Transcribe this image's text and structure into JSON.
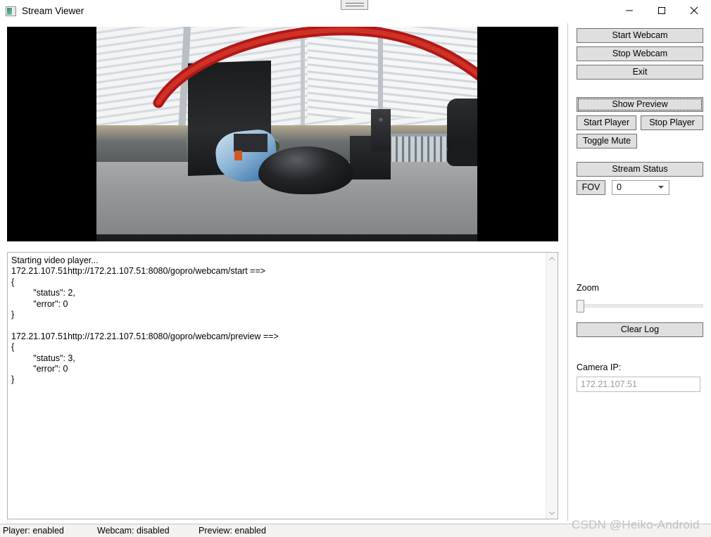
{
  "window": {
    "title": "Stream Viewer",
    "icon": "picture-icon",
    "controls": {
      "minimize": "minimize-icon",
      "maximize": "maximize-icon",
      "close": "close-icon"
    }
  },
  "video": {
    "label": "live-video-preview",
    "background_color": "#000000"
  },
  "controls": {
    "start_webcam": "Start Webcam",
    "stop_webcam": "Stop Webcam",
    "exit": "Exit",
    "show_preview": "Show Preview",
    "start_player": "Start Player",
    "stop_player": "Stop Player",
    "toggle_mute": "Toggle Mute",
    "stream_status": "Stream Status",
    "fov": "FOV",
    "fov_value": "0",
    "clear_log": "Clear Log",
    "zoom_label": "Zoom",
    "zoom_value": "0",
    "camera_ip_label": "Camera IP:",
    "camera_ip_value": "172.21.107.51"
  },
  "log": {
    "content": "Starting video player...\n172.21.107.51http://172.21.107.51:8080/gopro/webcam/start ==>\n{\n         \"status\": 2,\n         \"error\": 0\n}\n\n172.21.107.51http://172.21.107.51:8080/gopro/webcam/preview ==>\n{\n         \"status\": 3,\n         \"error\": 0\n}"
  },
  "status_bar": {
    "player": "Player: enabled",
    "webcam": "Webcam: disabled",
    "preview": "Preview: enabled"
  },
  "watermark": {
    "text": "CSDN @Heiko-Android"
  },
  "colors": {
    "button_face": "#dfdfdf",
    "button_border": "#707070",
    "status_bar_bg": "#f4f1ef",
    "watermark": "#c2c2c2"
  }
}
